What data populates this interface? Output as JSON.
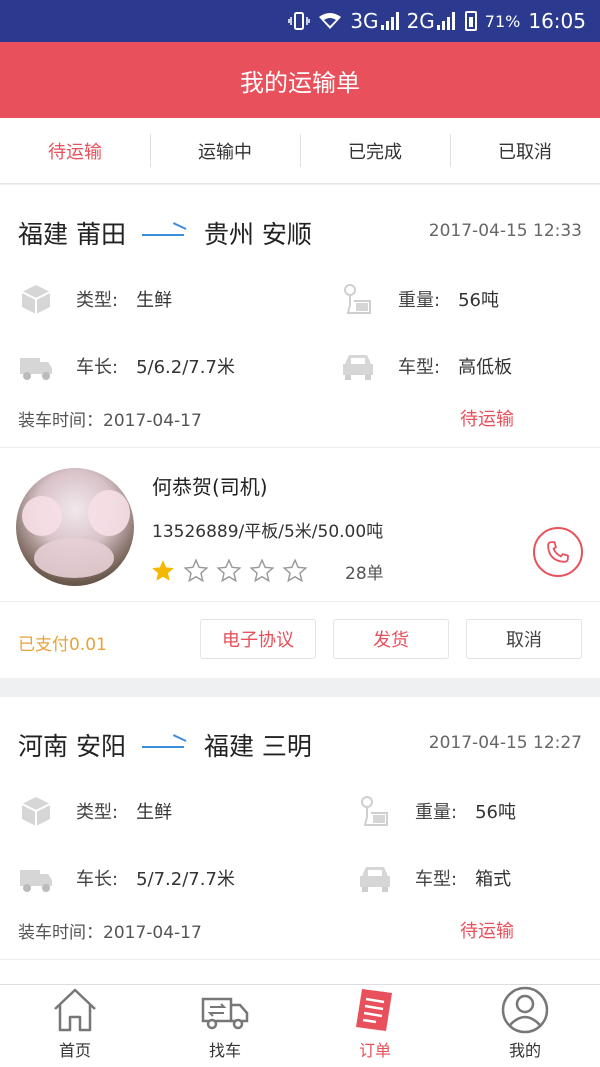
{
  "status_bar": {
    "network_1": "3G",
    "network_2": "2G",
    "battery": "71%",
    "time": "16:05"
  },
  "header": {
    "title": "我的运输单"
  },
  "tabs": [
    {
      "label": "待运输",
      "active": true
    },
    {
      "label": "运输中",
      "active": false
    },
    {
      "label": "已完成",
      "active": false
    },
    {
      "label": "已取消",
      "active": false
    }
  ],
  "orders": [
    {
      "from": "福建 莆田",
      "to": "贵州 安顺",
      "datetime": "2017-04-15 12:33",
      "type_label": "类型:",
      "type_value": "生鲜",
      "weight_label": "重量:",
      "weight_value": "56吨",
      "length_label": "车长:",
      "length_value": "5/6.2/7.7米",
      "model_label": "车型:",
      "model_value": "高低板",
      "load_time": "装车时间：2017-04-17",
      "status": "待运输",
      "driver": {
        "name": "何恭贺(司机)",
        "info": "13526889/平板/5米/50.00吨",
        "rating": 1,
        "rating_max": 5,
        "orders": "28单"
      },
      "paid": "已支付0.01",
      "actions": [
        "电子协议",
        "发货",
        "取消"
      ]
    },
    {
      "from": "河南 安阳",
      "to": "福建 三明",
      "datetime": "2017-04-15 12:27",
      "type_label": "类型:",
      "type_value": "生鲜",
      "weight_label": "重量:",
      "weight_value": "56吨",
      "length_label": "车长:",
      "length_value": "5/7.2/7.7米",
      "model_label": "车型:",
      "model_value": "箱式",
      "load_time": "装车时间：2017-04-17",
      "status": "待运输"
    }
  ],
  "bottom_nav": [
    {
      "label": "首页",
      "icon": "home-icon",
      "active": false
    },
    {
      "label": "找车",
      "icon": "truck-icon",
      "active": false
    },
    {
      "label": "订单",
      "icon": "order-icon",
      "active": true
    },
    {
      "label": "我的",
      "icon": "user-icon",
      "active": false
    }
  ],
  "colors": {
    "accent": "#e8505b",
    "status_bar": "#2b3a8f",
    "paid": "#e6a23c",
    "route_arrow": "#3a8fd9"
  }
}
